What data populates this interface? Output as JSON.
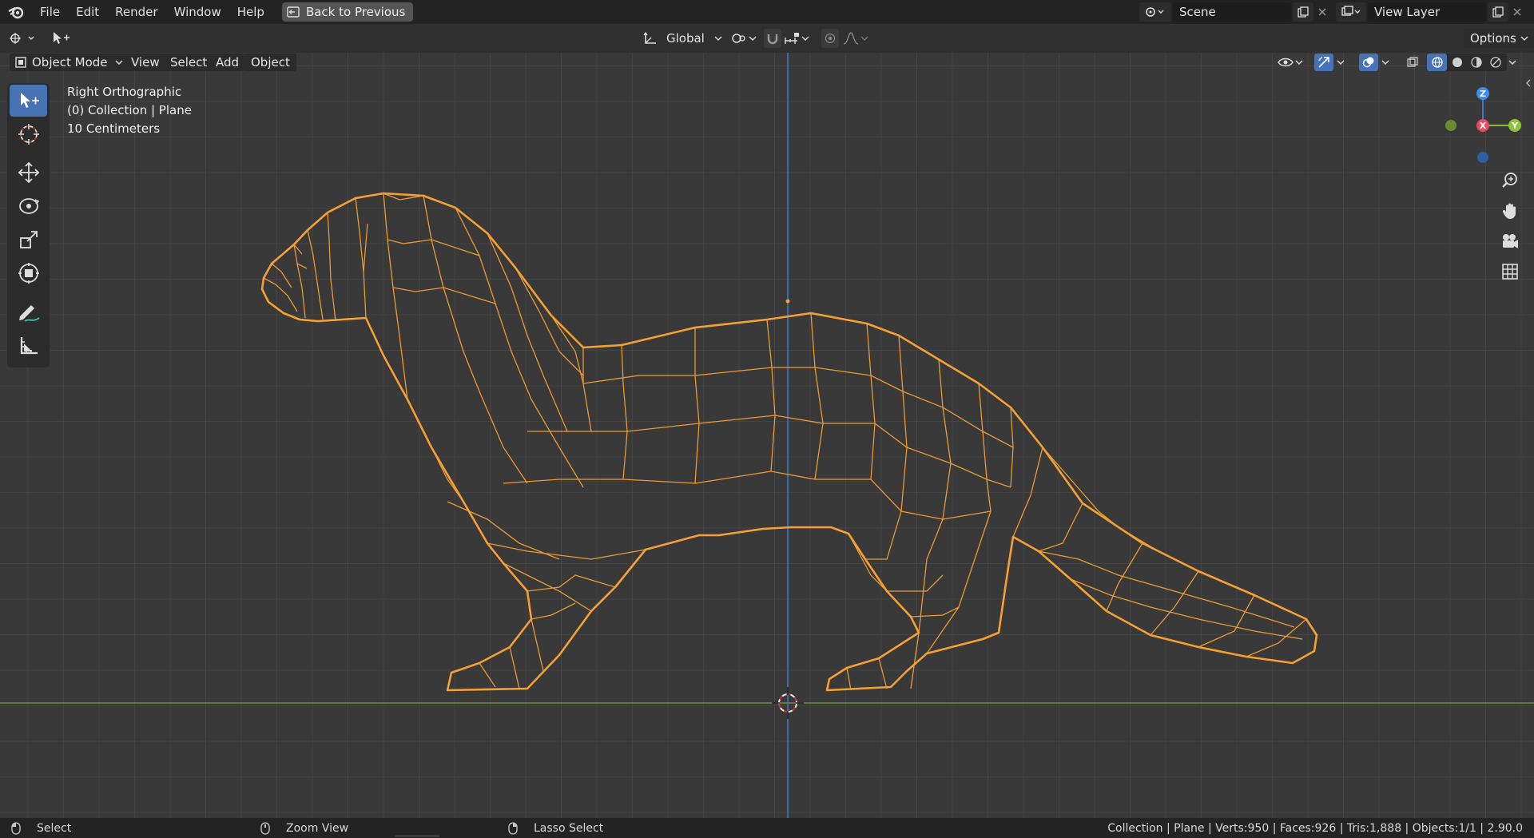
{
  "menu": {
    "file": "File",
    "edit": "Edit",
    "render": "Render",
    "window": "Window",
    "help": "Help",
    "back_to_previous": "Back to Previous"
  },
  "scene": {
    "name": "Scene"
  },
  "view_layer": {
    "name": "View Layer"
  },
  "tool_header": {
    "orientation": "Global",
    "options": "Options"
  },
  "viewport_header": {
    "mode": "Object Mode",
    "view": "View",
    "select": "Select",
    "add": "Add",
    "object": "Object"
  },
  "viewport_overlay": {
    "view_name": "Right Orthographic",
    "collection_info": "(0) Collection | Plane",
    "scale": "10 Centimeters"
  },
  "gizmo": {
    "z": "Z",
    "x": "X",
    "y": "Y"
  },
  "colors": {
    "accent_blue": "#4772b3",
    "wire_orange": "#f5a033",
    "axis_green": "#6f8a3a",
    "axis_blue": "#3d78c8"
  },
  "status": {
    "select": "Select",
    "zoom_view": "Zoom View",
    "lasso_select": "Lasso Select",
    "stats": "Collection | Plane | Verts:950 | Faces:926 | Tris:1,888 | Objects:1/1 | 2.90.0"
  }
}
